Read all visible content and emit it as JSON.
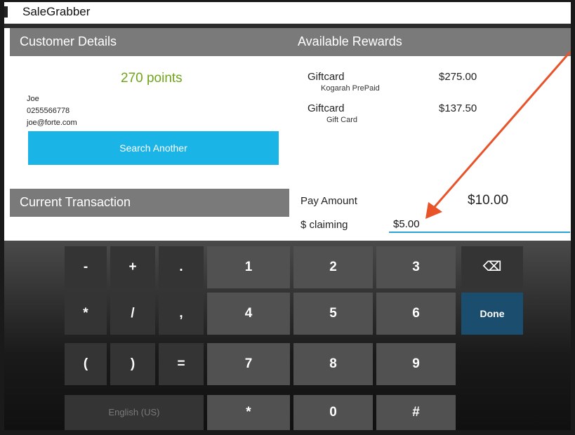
{
  "app": {
    "title": "SaleGrabber"
  },
  "customer": {
    "header": "Customer Details",
    "points": "270 points",
    "name": "Joe",
    "phone": "0255566778",
    "email": "joe@forte.com",
    "search_button": "Search Another"
  },
  "rewards": {
    "header": "Available Rewards",
    "items": [
      {
        "name": "Giftcard",
        "sub": "Kogarah PrePaid",
        "amount": "$275.00"
      },
      {
        "name": "Giftcard",
        "sub": "Gift Card",
        "amount": "$137.50"
      }
    ]
  },
  "transaction": {
    "header": "Current Transaction",
    "pay_label": "Pay Amount",
    "pay_value": "$10.00",
    "claim_label": "$ claiming",
    "claim_value": "$5.00"
  },
  "keyboard": {
    "row1": [
      "-",
      "+",
      ".",
      "1",
      "2",
      "3",
      "⌫"
    ],
    "row2": [
      "*",
      "/",
      ",",
      "4",
      "5",
      "6",
      "Done"
    ],
    "row3": [
      "(",
      ")",
      "=",
      "7",
      "8",
      "9"
    ],
    "row4": [
      "English (US)",
      "*",
      "0",
      "#"
    ],
    "accent_color": "#1b4e6e"
  },
  "annotation": {
    "color": "#e8532a"
  }
}
